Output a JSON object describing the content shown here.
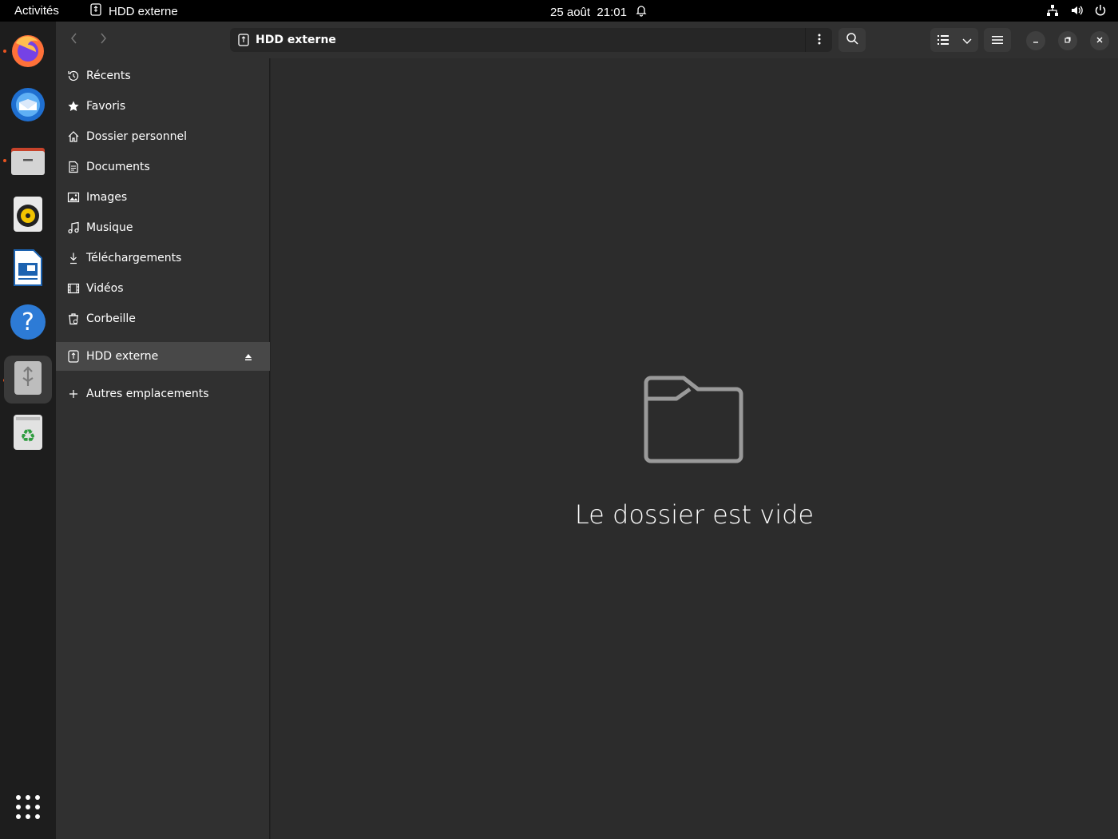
{
  "topbar": {
    "activities": "Activités",
    "app_name": "HDD externe",
    "clock": "25 août  21:01"
  },
  "dock": {
    "items": [
      {
        "name": "firefox",
        "icon": "firefox-icon",
        "running": true
      },
      {
        "name": "thunderbird",
        "icon": "thunderbird-icon",
        "running": false
      },
      {
        "name": "files",
        "icon": "files-icon",
        "running": true
      },
      {
        "name": "rhythmbox",
        "icon": "rhythmbox-icon",
        "running": false
      },
      {
        "name": "libreoffice-writer",
        "icon": "writer-icon",
        "running": false
      },
      {
        "name": "help",
        "icon": "help-icon",
        "running": false
      },
      {
        "name": "usb-drive",
        "icon": "usb-drive-icon",
        "running": true,
        "active": true
      },
      {
        "name": "trash",
        "icon": "trash-icon",
        "running": false
      }
    ]
  },
  "header": {
    "path_label": "HDD externe"
  },
  "sidebar": {
    "items": [
      {
        "label": "Récents",
        "icon": "clock-icon"
      },
      {
        "label": "Favoris",
        "icon": "star-icon"
      },
      {
        "label": "Dossier personnel",
        "icon": "home-icon"
      },
      {
        "label": "Documents",
        "icon": "document-icon"
      },
      {
        "label": "Images",
        "icon": "image-icon"
      },
      {
        "label": "Musique",
        "icon": "music-icon"
      },
      {
        "label": "Téléchargements",
        "icon": "download-icon"
      },
      {
        "label": "Vidéos",
        "icon": "video-icon"
      },
      {
        "label": "Corbeille",
        "icon": "trash-icon"
      }
    ],
    "drive": {
      "label": "HDD externe",
      "icon": "usb-drive-icon"
    },
    "other": {
      "label": "Autres emplacements",
      "icon": "plus-icon"
    }
  },
  "content": {
    "empty_message": "Le dossier est vide"
  },
  "colors": {
    "accent": "#e95420",
    "sidebar_bg": "#303030",
    "content_bg": "#2c2c2c",
    "topbar_bg": "#000000"
  }
}
